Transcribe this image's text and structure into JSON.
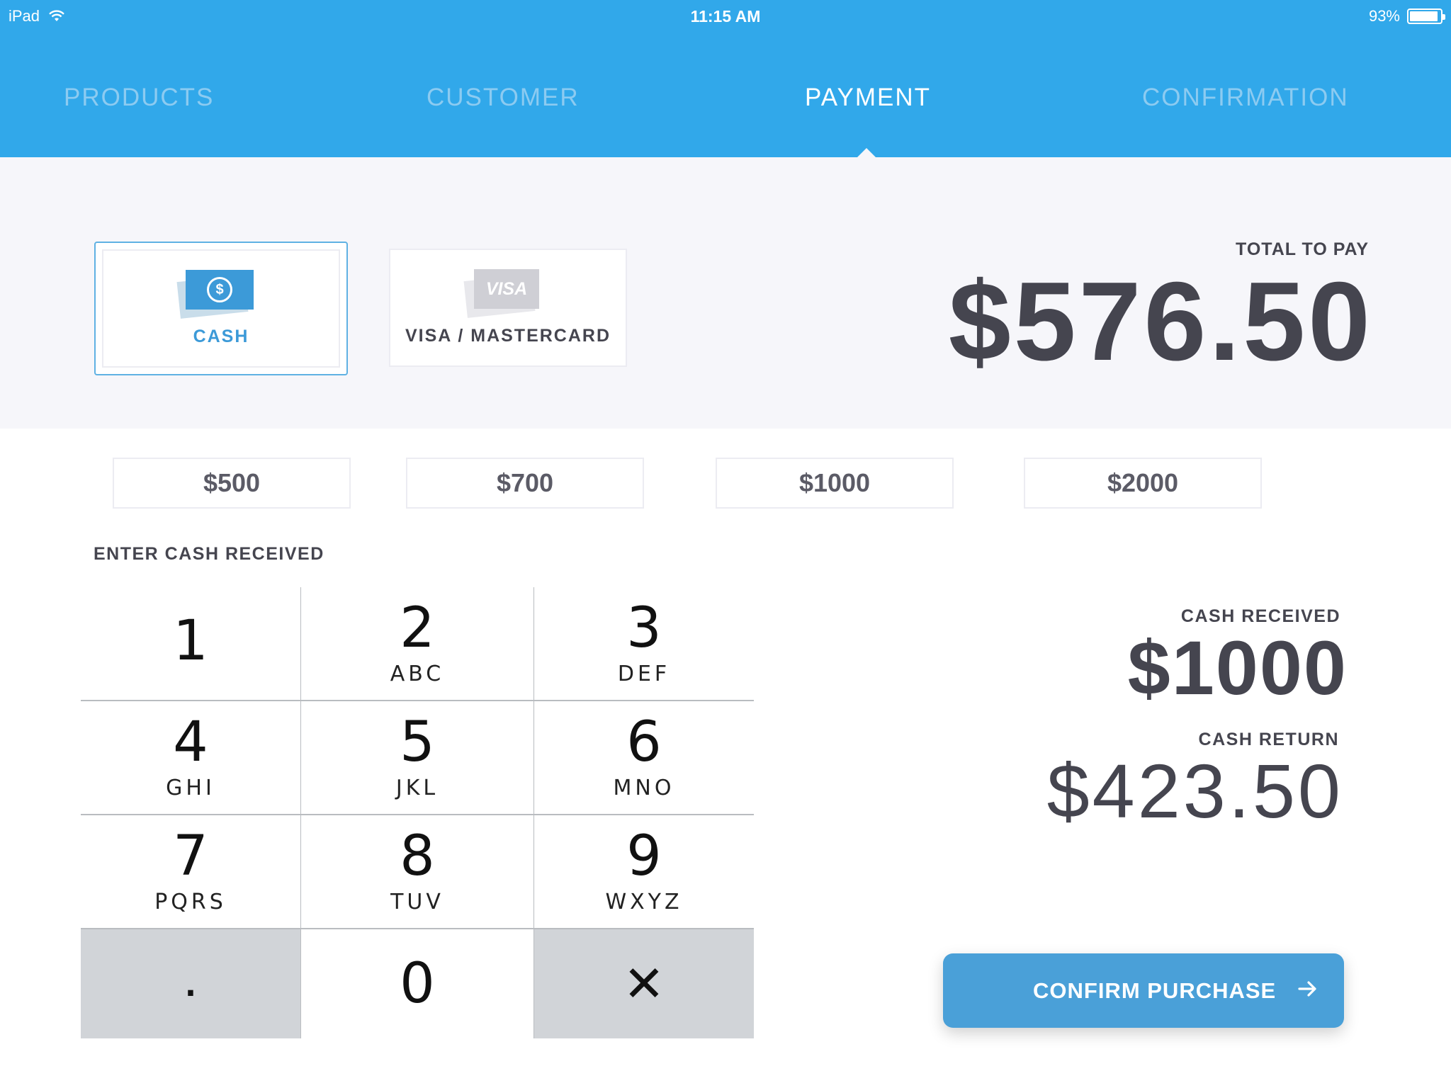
{
  "status_bar": {
    "device": "iPad",
    "time": "11:15 AM",
    "battery": "93%",
    "battery_level": 0.93
  },
  "tabs": [
    {
      "label": "PRODUCTS",
      "active": false
    },
    {
      "label": "CUSTOMER",
      "active": false
    },
    {
      "label": "PAYMENT",
      "active": true
    },
    {
      "label": "CONFIRMATION",
      "active": false
    }
  ],
  "payment_methods": {
    "cash": {
      "label": "CASH",
      "icon": "cash-icon",
      "icon_glyph": "$",
      "selected": true
    },
    "card": {
      "label": "VISA / MASTERCARD",
      "icon": "visa-card-icon",
      "icon_text": "VISA",
      "selected": false
    }
  },
  "total": {
    "label": "TOTAL TO PAY",
    "value": "$576.50"
  },
  "quick_amounts": [
    "$500",
    "$700",
    "$1000",
    "$2000"
  ],
  "entry_label": "ENTER CASH RECEIVED",
  "keypad": {
    "keys": [
      {
        "digit": "1",
        "letters": ""
      },
      {
        "digit": "2",
        "letters": "ABC"
      },
      {
        "digit": "3",
        "letters": "DEF"
      },
      {
        "digit": "4",
        "letters": "GHI"
      },
      {
        "digit": "5",
        "letters": "JKL"
      },
      {
        "digit": "6",
        "letters": "MNO"
      },
      {
        "digit": "7",
        "letters": "PQRS"
      },
      {
        "digit": "8",
        "letters": "TUV"
      },
      {
        "digit": "9",
        "letters": "WXYZ"
      }
    ],
    "decimal": ".",
    "zero": "0",
    "delete": "✕"
  },
  "cash_received": {
    "label": "CASH RECEIVED",
    "value": "$1000"
  },
  "cash_return": {
    "label": "CASH RETURN",
    "value": "$423.50"
  },
  "confirm_button": {
    "label": "CONFIRM PURCHASE",
    "icon": "arrow-right-icon"
  },
  "colors": {
    "header": "#31a8ea",
    "accent": "#3c9ad8",
    "button": "#4aa0d8",
    "text": "#45454f",
    "panel": "#f6f6fa"
  }
}
